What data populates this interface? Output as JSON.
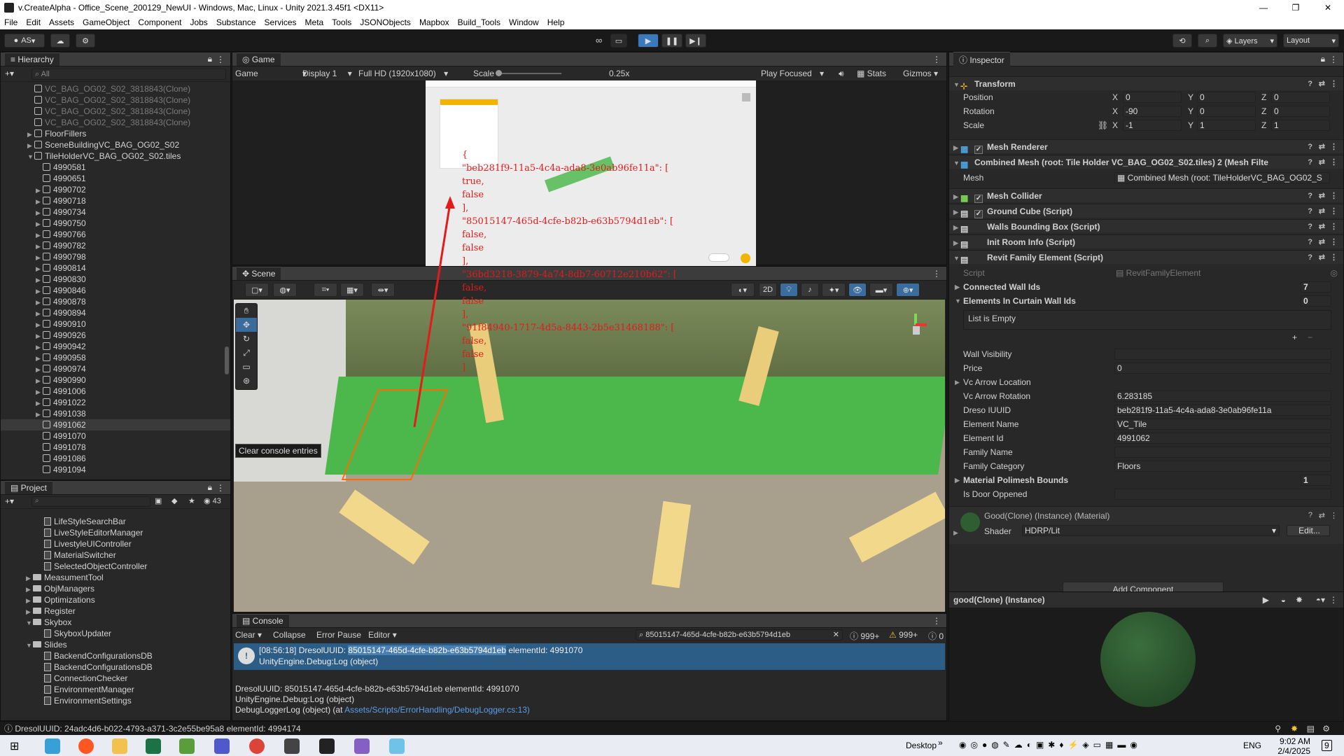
{
  "window": {
    "title": "v.CreateAlpha - Office_Scene_200129_NewUI - Windows, Mac, Linux - Unity 2021.3.45f1 <DX11>"
  },
  "menu": [
    "File",
    "Edit",
    "Assets",
    "GameObject",
    "Component",
    "Jobs",
    "Substance",
    "Services",
    "Meta",
    "Tools",
    "JSONObjects",
    "Mapbox",
    "Build_Tools",
    "Window",
    "Help"
  ],
  "toolbar": {
    "account": "AS",
    "layers": "Layers",
    "layout": "Layout"
  },
  "hierarchy": {
    "title": "Hierarchy",
    "search_placeholder": "All",
    "items": [
      {
        "label": "VC_BAG_OG02_S02_3818843(Clone)",
        "dim": true,
        "indent": 1,
        "arrow": ""
      },
      {
        "label": "VC_BAG_OG02_S02_3818843(Clone)",
        "dim": true,
        "indent": 1,
        "arrow": ""
      },
      {
        "label": "VC_BAG_OG02_S02_3818843(Clone)",
        "dim": true,
        "indent": 1,
        "arrow": ""
      },
      {
        "label": "VC_BAG_OG02_S02_3818843(Clone)",
        "dim": true,
        "indent": 1,
        "arrow": ""
      },
      {
        "label": "FloorFillers",
        "dim": false,
        "indent": 1,
        "arrow": "▶"
      },
      {
        "label": "SceneBuildingVC_BAG_OG02_S02",
        "dim": false,
        "indent": 1,
        "arrow": "▶"
      },
      {
        "label": "TileHolderVC_BAG_OG02_S02.tiles",
        "dim": false,
        "indent": 1,
        "arrow": "▼"
      },
      {
        "label": "4990581",
        "dim": false,
        "indent": 2,
        "arrow": ""
      },
      {
        "label": "4990651",
        "dim": false,
        "indent": 2,
        "arrow": ""
      },
      {
        "label": "4990702",
        "dim": false,
        "indent": 2,
        "arrow": "▶"
      },
      {
        "label": "4990718",
        "dim": false,
        "indent": 2,
        "arrow": "▶"
      },
      {
        "label": "4990734",
        "dim": false,
        "indent": 2,
        "arrow": "▶"
      },
      {
        "label": "4990750",
        "dim": false,
        "indent": 2,
        "arrow": "▶"
      },
      {
        "label": "4990766",
        "dim": false,
        "indent": 2,
        "arrow": "▶"
      },
      {
        "label": "4990782",
        "dim": false,
        "indent": 2,
        "arrow": "▶"
      },
      {
        "label": "4990798",
        "dim": false,
        "indent": 2,
        "arrow": "▶"
      },
      {
        "label": "4990814",
        "dim": false,
        "indent": 2,
        "arrow": "▶"
      },
      {
        "label": "4990830",
        "dim": false,
        "indent": 2,
        "arrow": "▶"
      },
      {
        "label": "4990846",
        "dim": false,
        "indent": 2,
        "arrow": "▶"
      },
      {
        "label": "4990878",
        "dim": false,
        "indent": 2,
        "arrow": "▶"
      },
      {
        "label": "4990894",
        "dim": false,
        "indent": 2,
        "arrow": "▶"
      },
      {
        "label": "4990910",
        "dim": false,
        "indent": 2,
        "arrow": "▶"
      },
      {
        "label": "4990926",
        "dim": false,
        "indent": 2,
        "arrow": "▶"
      },
      {
        "label": "4990942",
        "dim": false,
        "indent": 2,
        "arrow": "▶"
      },
      {
        "label": "4990958",
        "dim": false,
        "indent": 2,
        "arrow": "▶"
      },
      {
        "label": "4990974",
        "dim": false,
        "indent": 2,
        "arrow": "▶"
      },
      {
        "label": "4990990",
        "dim": false,
        "indent": 2,
        "arrow": "▶"
      },
      {
        "label": "4991006",
        "dim": false,
        "indent": 2,
        "arrow": "▶"
      },
      {
        "label": "4991022",
        "dim": false,
        "indent": 2,
        "arrow": "▶"
      },
      {
        "label": "4991038",
        "dim": false,
        "indent": 2,
        "arrow": "▶"
      },
      {
        "label": "4991062",
        "dim": false,
        "indent": 2,
        "arrow": "",
        "selected": true
      },
      {
        "label": "4991070",
        "dim": false,
        "indent": 2,
        "arrow": ""
      },
      {
        "label": "4991078",
        "dim": false,
        "indent": 2,
        "arrow": ""
      },
      {
        "label": "4991086",
        "dim": false,
        "indent": 2,
        "arrow": ""
      },
      {
        "label": "4991094",
        "dim": false,
        "indent": 2,
        "arrow": ""
      }
    ]
  },
  "project": {
    "title": "Project",
    "count": "43",
    "items": [
      {
        "label": "LifeStyleSearchBar",
        "type": "script",
        "indent": 3
      },
      {
        "label": "LiveStyleEditorManager",
        "type": "script",
        "indent": 3
      },
      {
        "label": "LivestyleUIController",
        "type": "script",
        "indent": 3
      },
      {
        "label": "MaterialSwitcher",
        "type": "script",
        "indent": 3
      },
      {
        "label": "SelectedObjectController",
        "type": "script",
        "indent": 3
      },
      {
        "label": "MeasumentTool",
        "type": "folder",
        "indent": 2,
        "arrow": "▶"
      },
      {
        "label": "ObjManagers",
        "type": "folder",
        "indent": 2,
        "arrow": "▶"
      },
      {
        "label": "Optimizations",
        "type": "folder",
        "indent": 2,
        "arrow": "▶"
      },
      {
        "label": "Register",
        "type": "folder",
        "indent": 2,
        "arrow": "▶"
      },
      {
        "label": "Skybox",
        "type": "folder",
        "indent": 2,
        "arrow": "▼"
      },
      {
        "label": "SkyboxUpdater",
        "type": "script",
        "indent": 3
      },
      {
        "label": "Slides",
        "type": "folder",
        "indent": 2,
        "arrow": "▼"
      },
      {
        "label": "BackendConfigurationsDB",
        "type": "script",
        "indent": 3
      },
      {
        "label": "BackendConfigurationsDB",
        "type": "script",
        "indent": 3
      },
      {
        "label": "ConnectionChecker",
        "type": "script",
        "indent": 3
      },
      {
        "label": "EnvironmentManager",
        "type": "script",
        "indent": 3
      },
      {
        "label": "EnvironmentSettings",
        "type": "script",
        "indent": 3
      }
    ]
  },
  "game": {
    "tab": "Game",
    "mode": "Game",
    "display": "Display 1",
    "resolution": "Full HD (1920x1080)",
    "scale_label": "Scale",
    "scale_value": "0.25x",
    "play_focused": "Play Focused",
    "stats": "Stats",
    "gizmos": "Gizmos"
  },
  "overlay_json": [
    "{",
    "\"beb281f9-11a5-4c4a-ada8-3e0ab96fe11a\": [",
    "true,",
    "false",
    "],",
    "\"85015147-465d-4cfe-b82b-e63b5794d1eb\": [",
    "false,",
    "false",
    "],",
    "\"36bd3218-3879-4a74-8db7-60712e210b62\": [",
    "false,",
    "false",
    "],",
    "\"91f84940-1717-4d5a-8443-2b5e31468188\": [",
    "false,",
    "false",
    "]"
  ],
  "scene": {
    "tab": "Scene",
    "mode2d": "2D",
    "tooltip": "Clear console entries"
  },
  "console": {
    "tab": "Console",
    "clear": "Clear",
    "collapse": "Collapse",
    "error_pause": "Error Pause",
    "editor": "Editor",
    "search": "85015147-465d-4cfe-b82b-e63b5794d1eb",
    "count_info": "999+",
    "count_warn": "999+",
    "count_err": "0",
    "entry_time": "[08:56:18]",
    "entry_prefix": "DresolUUID:",
    "entry_highlight": "85015147-465d-4cfe-b82b-e63b5794d1eb",
    "entry_suffix": "elementId: 4991070",
    "entry_line2": "UnityEngine.Debug:Log (object)",
    "detail_line1": "DresolUUID: 85015147-465d-4cfe-b82b-e63b5794d1eb elementId: 4991070",
    "detail_line2": "UnityEngine.Debug:Log (object)",
    "detail_line3": "DebugLoggerLog (object) (at",
    "detail_link": "Assets/Scripts/ErrorHandling/DebugLogger.cs:13)"
  },
  "status_bar": "DresolUUID: 24adc4d6-b022-4793-a371-3c2e55be95a8 elementId: 4994174",
  "inspector": {
    "title": "Inspector",
    "transform": {
      "label": "Transform",
      "position": {
        "label": "Position",
        "x": "0",
        "y": "0",
        "z": "0"
      },
      "rotation": {
        "label": "Rotation",
        "x": "-90",
        "y": "0",
        "z": "0"
      },
      "scale": {
        "label": "Scale",
        "x": "-1",
        "y": "1",
        "z": "1"
      }
    },
    "components": {
      "mesh_renderer": "Mesh Renderer",
      "mesh_filter": "Combined Mesh (root: Tile Holder VC_BAG_OG02_S02.tiles) 2 (Mesh Filte",
      "mesh_label": "Mesh",
      "mesh_value": "Combined Mesh (root: TileHolderVC_BAG_OG02_S",
      "mesh_collider": "Mesh Collider",
      "ground_cube": "Ground Cube (Script)",
      "walls_bbox": "Walls Bounding Box (Script)",
      "init_room": "Init Room Info (Script)",
      "revit_family": "Revit Family Element (Script)"
    },
    "revit": {
      "script_label": "Script",
      "script_value": "RevitFamilyElement",
      "connected_walls": "Connected Wall Ids",
      "connected_walls_count": "7",
      "curtain_walls": "Elements In Curtain Wall Ids",
      "curtain_walls_count": "0",
      "list_empty": "List is Empty",
      "wall_visibility": "Wall Visibility",
      "price_label": "Price",
      "price": "0",
      "arrow_location": "Vc Arrow Location",
      "arrow_rotation_label": "Vc Arrow Rotation",
      "arrow_rotation": "6.283185",
      "dreso_label": "Dreso IUUID",
      "dreso": "beb281f9-11a5-4c4a-ada8-3e0ab96fe11a",
      "element_name_label": "Element Name",
      "element_name": "VC_Tile",
      "element_id_label": "Element Id",
      "element_id": "4991062",
      "family_name_label": "Family Name",
      "family_category_label": "Family Category",
      "family_category": "Floors",
      "polimesh_label": "Material Polimesh Bounds",
      "polimesh_count": "1",
      "door_label": "Is Door Oppened"
    },
    "material": {
      "name": "Good(Clone) (Instance) (Material)",
      "shader_label": "Shader",
      "shader": "HDRP/Lit",
      "edit": "Edit..."
    },
    "add_component": "Add Component",
    "preview_title": "good(Clone) (Instance)"
  },
  "taskbar": {
    "desktop": "Desktop",
    "lang": "ENG",
    "time": "9:02 AM",
    "date": "2/4/2025",
    "notif": "9"
  },
  "colors": {
    "accent": "#2c5d87",
    "selected": "#2c5d87",
    "grass": "#4cb84c",
    "sand": "#a59e8e"
  }
}
